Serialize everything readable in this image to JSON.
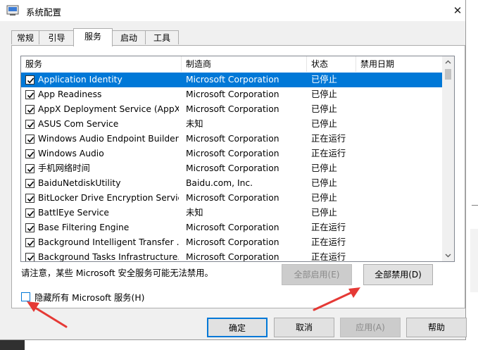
{
  "window": {
    "title": "系统配置",
    "close_glyph": "✕"
  },
  "tabs": [
    {
      "label": "常规"
    },
    {
      "label": "引导"
    },
    {
      "label": "服务",
      "active": true
    },
    {
      "label": "启动"
    },
    {
      "label": "工具"
    }
  ],
  "table": {
    "columns": [
      "服务",
      "制造商",
      "状态",
      "禁用日期"
    ],
    "rows": [
      {
        "checked": true,
        "service": "Application Identity",
        "maker": "Microsoft Corporation",
        "status": "已停止",
        "date": "",
        "selected": true
      },
      {
        "checked": true,
        "service": "App Readiness",
        "maker": "Microsoft Corporation",
        "status": "已停止",
        "date": ""
      },
      {
        "checked": true,
        "service": "AppX Deployment Service (AppX...",
        "maker": "Microsoft Corporation",
        "status": "已停止",
        "date": ""
      },
      {
        "checked": true,
        "service": "ASUS Com Service",
        "maker": "未知",
        "status": "已停止",
        "date": ""
      },
      {
        "checked": true,
        "service": "Windows Audio Endpoint Builder",
        "maker": "Microsoft Corporation",
        "status": "正在运行",
        "date": ""
      },
      {
        "checked": true,
        "service": "Windows Audio",
        "maker": "Microsoft Corporation",
        "status": "正在运行",
        "date": ""
      },
      {
        "checked": true,
        "service": "手机网络时间",
        "maker": "Microsoft Corporation",
        "status": "已停止",
        "date": ""
      },
      {
        "checked": true,
        "service": "BaiduNetdiskUtility",
        "maker": "Baidu.com, Inc.",
        "status": "已停止",
        "date": ""
      },
      {
        "checked": true,
        "service": "BitLocker Drive Encryption Service",
        "maker": "Microsoft Corporation",
        "status": "已停止",
        "date": ""
      },
      {
        "checked": true,
        "service": "BattlEye Service",
        "maker": "未知",
        "status": "已停止",
        "date": ""
      },
      {
        "checked": true,
        "service": "Base Filtering Engine",
        "maker": "Microsoft Corporation",
        "status": "正在运行",
        "date": ""
      },
      {
        "checked": true,
        "service": "Background Intelligent Transfer ...",
        "maker": "Microsoft Corporation",
        "status": "正在运行",
        "date": ""
      },
      {
        "checked": true,
        "service": "Background Tasks Infrastructure...",
        "maker": "Microsoft Corporation",
        "status": "正在运行",
        "date": ""
      }
    ]
  },
  "note": "请注意，某些 Microsoft 安全服务可能无法禁用。",
  "buttons": {
    "enable_all": "全部启用(E)",
    "disable_all": "全部禁用(D)",
    "ok": "确定",
    "cancel": "取消",
    "apply": "应用(A)",
    "help": "帮助"
  },
  "hide_ms": {
    "label": "隐藏所有 Microsoft 服务(H)",
    "checked": false
  },
  "colors": {
    "selection": "#0078d7",
    "annotation_arrow": "#e53935"
  },
  "icons": {
    "title": "msconfig-icon",
    "close": "close-icon",
    "checkbox": "checkmark-icon",
    "scroll_up": "arrow-up-icon",
    "scroll_down": "arrow-down-icon",
    "annotation": "red-arrow-icon"
  }
}
